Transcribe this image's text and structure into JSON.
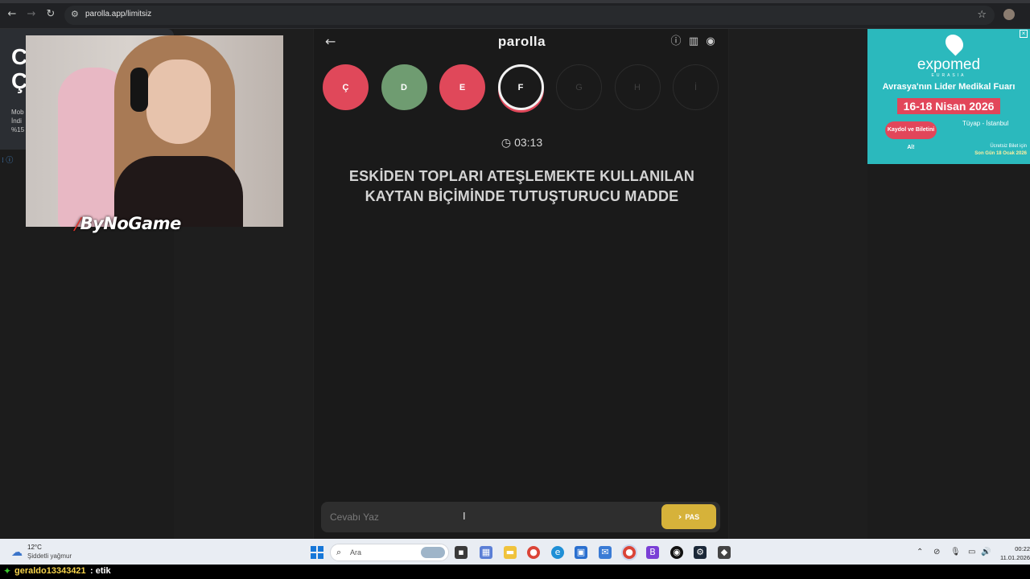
{
  "browser": {
    "url": "parolla.app/limitsiz",
    "back_icon": "←",
    "forward_icon": "→",
    "reload_icon": "↻",
    "site_info_icon": "⚙",
    "bookmark_icon": "☆"
  },
  "left_ad": {
    "big_text": "C\nÇ",
    "small_text": "Mob\nİndi\n%15"
  },
  "overlay": {
    "brand_mark": "⧸",
    "brand": "ByNoGame"
  },
  "game": {
    "logo": "parolla",
    "back_icon": "←",
    "info_icon": "ⓘ",
    "stats_icon": "▥",
    "profile_icon": "◉",
    "letters": [
      {
        "letter": "Ç",
        "state": "wrong"
      },
      {
        "letter": "D",
        "state": "correct"
      },
      {
        "letter": "E",
        "state": "wrong"
      },
      {
        "letter": "F",
        "state": "current"
      },
      {
        "letter": "G",
        "state": "pending"
      },
      {
        "letter": "H",
        "state": "pending"
      },
      {
        "letter": "İ",
        "state": "pending"
      }
    ],
    "timer_icon": "◷",
    "timer": "03:13",
    "question": "ESKİDEN TOPLARI ATEŞLEMEKTE KULLANILAN KAYTAN BİÇİMİNDE TUTUŞTURUCU MADDE",
    "answer_placeholder": "Cevabı Yaz",
    "answer_value": "",
    "pass_icon": "›",
    "pass_label": "PAS"
  },
  "right_ad": {
    "close": "×",
    "brand": "expomed",
    "sub": "EURASIA",
    "headline": "Avrasya'nın Lider Medikal Fuarı",
    "dates": "16-18 Nisan 2026",
    "cta": "Kaydol ve Biletini Al!",
    "venue": "Tüyap - İstanbul",
    "free_line1": "Ücretsiz Bilet için",
    "free_line2": "Son Gün 18 Ocak 2026"
  },
  "taskbar": {
    "weather_icon": "☁",
    "temperature": "12°C",
    "condition": "Şiddetli yağmur",
    "search_icon": "⌕",
    "search_label": "Ara",
    "time": "00:22",
    "date": "11.01.2026",
    "tray_icons": [
      "⌃",
      "⊘",
      "🎙",
      "▭",
      "🔊"
    ]
  },
  "chat": {
    "badge_icon": "✦",
    "username": "geraldo13343421",
    "message": ": etik"
  },
  "colors": {
    "wrong": "#e0485a",
    "correct": "#6f9c71",
    "pass_button": "#d6b23a",
    "ad_background": "#2bb9bd"
  }
}
